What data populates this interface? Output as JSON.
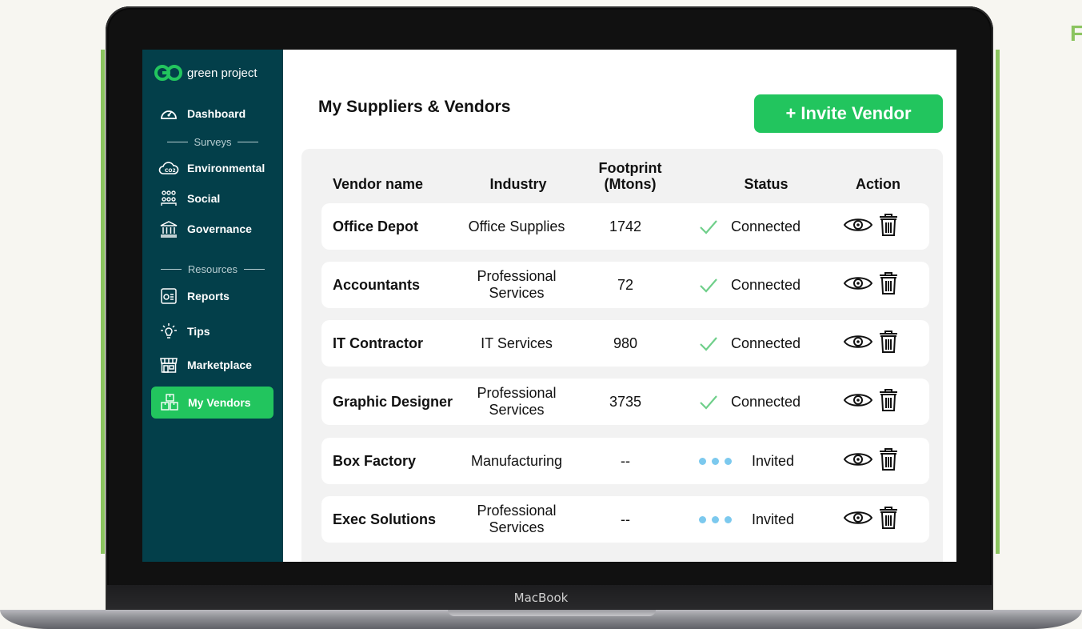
{
  "device_brand": "MacBook",
  "edge_letter": "F",
  "app": {
    "logo_text": "green project",
    "logo_mark": "GP"
  },
  "sidebar": {
    "items": [
      {
        "label": "Dashboard",
        "icon": "gauge-icon"
      },
      {
        "label": "Environmental",
        "icon": "co2-cloud-icon"
      },
      {
        "label": "Social",
        "icon": "people-group-icon"
      },
      {
        "label": "Governance",
        "icon": "bank-building-icon"
      },
      {
        "label": "Reports",
        "icon": "report-icon"
      },
      {
        "label": "Tips",
        "icon": "lightbulb-icon"
      },
      {
        "label": "Marketplace",
        "icon": "storefront-icon"
      },
      {
        "label": "My Vendors",
        "icon": "boxes-icon",
        "active": true
      }
    ],
    "section_surveys": "Surveys",
    "section_resources": "Resources"
  },
  "main": {
    "title": "My Suppliers & Vendors",
    "invite_label": "+ Invite Vendor"
  },
  "table": {
    "headers": {
      "name": "Vendor name",
      "industry": "Industry",
      "footprint_line1": "Footprint",
      "footprint_line2": "(Mtons)",
      "status": "Status",
      "action": "Action"
    },
    "rows": [
      {
        "name": "Office Depot",
        "industry_1": "Office Supplies",
        "industry_2": "",
        "footprint": "1742",
        "status": "Connected",
        "status_type": "connected"
      },
      {
        "name": "Accountants",
        "industry_1": "Professional",
        "industry_2": "Services",
        "footprint": "72",
        "status": "Connected",
        "status_type": "connected"
      },
      {
        "name": "IT Contractor",
        "industry_1": "IT Services",
        "industry_2": "",
        "footprint": "980",
        "status": "Connected",
        "status_type": "connected"
      },
      {
        "name": "Graphic Designer",
        "industry_1": "Professional",
        "industry_2": "Services",
        "footprint": "3735",
        "status": "Connected",
        "status_type": "connected"
      },
      {
        "name": "Box Factory",
        "industry_1": "Manufacturing",
        "industry_2": "",
        "footprint": "--",
        "status": "Invited",
        "status_type": "invited"
      },
      {
        "name": "Exec Solutions",
        "industry_1": "Professional",
        "industry_2": "Services",
        "footprint": "--",
        "status": "Invited",
        "status_type": "invited"
      }
    ]
  },
  "colors": {
    "accent_green": "#22c55e",
    "sidebar_bg": "#033f4a",
    "check_green": "#6fcf8a",
    "invited_dot": "#7cc9ee",
    "frame_green": "#8bc45f"
  }
}
